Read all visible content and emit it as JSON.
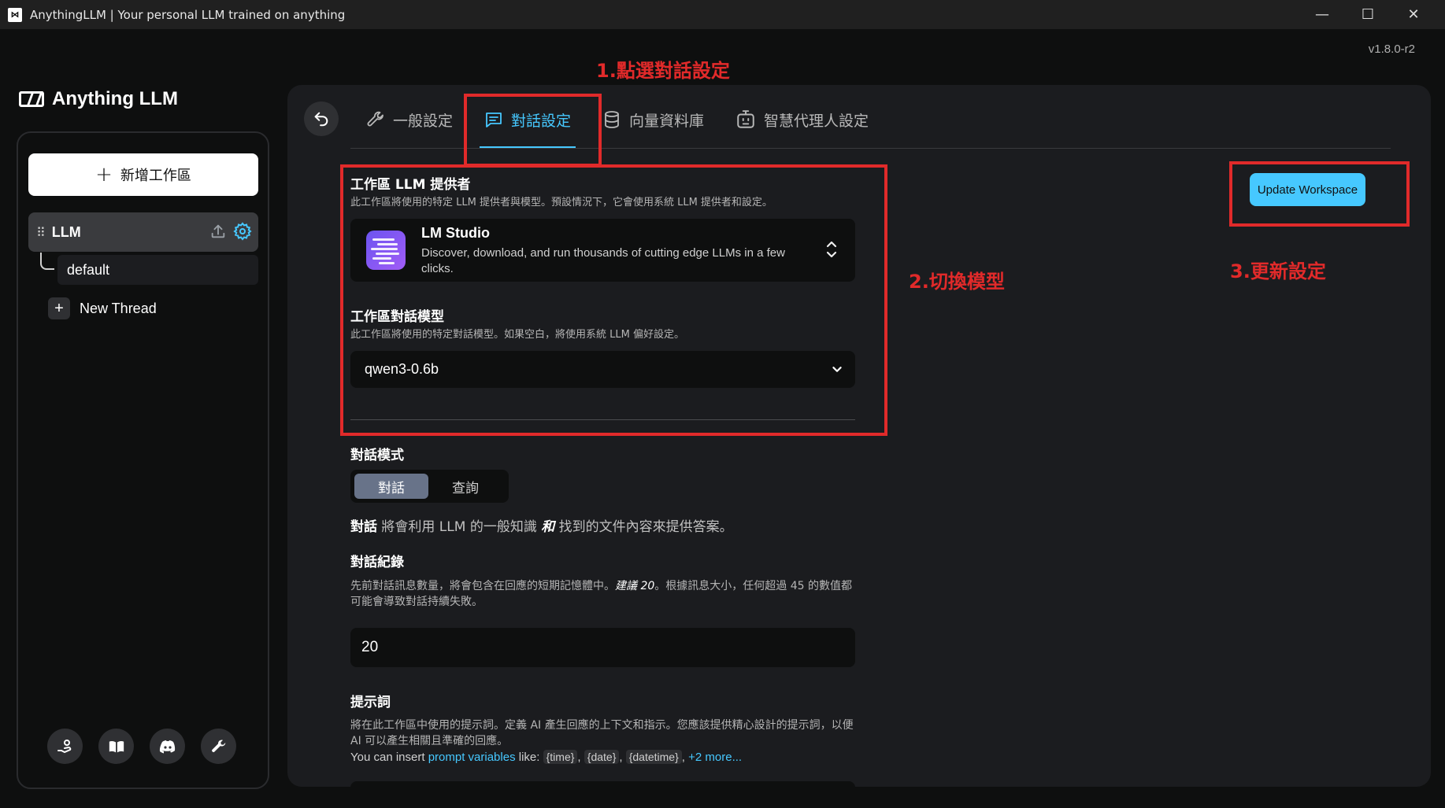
{
  "window": {
    "icon": "anythingllm-app-icon",
    "icon_text": "⋈",
    "title": "AnythingLLM | Your personal LLM trained on anything",
    "minimize": "—",
    "maximize": "☐",
    "close": "✕"
  },
  "version": "v1.8.0-r2",
  "logo": {
    "text": "Anything LLM"
  },
  "sidebar": {
    "new_workspace_label": "新增工作區",
    "new_workspace_plus": "+",
    "workspace": {
      "drag_handle": "⠿",
      "name": "LLM"
    },
    "thread": {
      "name": "default"
    },
    "new_thread_label": "New Thread",
    "new_thread_plus": "+",
    "footer_icons": [
      "community-hub-icon",
      "docs-book-icon",
      "discord-icon",
      "settings-wrench-icon"
    ]
  },
  "tabs": [
    {
      "label": "一般設定",
      "icon": "wrench-icon"
    },
    {
      "label": "對話設定",
      "icon": "chat-icon",
      "active": true
    },
    {
      "label": "向量資料庫",
      "icon": "database-icon"
    },
    {
      "label": "智慧代理人設定",
      "icon": "robot-icon"
    }
  ],
  "llm_provider": {
    "label": "工作區 LLM 提供者",
    "description": "此工作區將使用的特定 LLM 提供者與模型。預設情況下，它會使用系統 LLM 提供者和設定。",
    "name": "LM Studio",
    "provider_description": "Discover, download, and run thousands of cutting edge LLMs in a few clicks."
  },
  "chat_model": {
    "label": "工作區對話模型",
    "description": "此工作區將使用的特定對話模型。如果空白，將使用系統 LLM 偏好設定。",
    "value": "qwen3-0.6b"
  },
  "chat_mode": {
    "label": "對話模式",
    "options": [
      "對話",
      "查詢"
    ],
    "selected": "對話",
    "desc_bold": "對話",
    "desc_part1": " 將會利用 LLM 的一般知識 ",
    "desc_italic": "和",
    "desc_part2": " 找到的文件內容來提供答案。"
  },
  "chat_history": {
    "label": "對話紀錄",
    "desc_part1": "先前對話訊息數量，將會包含在回應的短期記憶體中。",
    "desc_italic": "建議 20",
    "desc_part2": "。根據訊息大小，任何超過 45 的數值都可能會導致對話持續失敗。",
    "value": "20"
  },
  "prompt": {
    "label": "提示詞",
    "description": "將在此工作區中使用的提示詞。定義 AI 產生回應的上下文和指示。您應該提供精心設計的提示詞，以便 AI 可以產生相關且準確的回應。",
    "vars_prefix": "You can insert",
    "vars_link": "prompt variables",
    "vars_like": "like:",
    "var_chips": [
      "{time}",
      "{date}",
      "{datetime}"
    ],
    "vars_more": "+2 more..."
  },
  "update_button_label": "Update Workspace",
  "annotations": [
    {
      "text": "1.點選對話設定"
    },
    {
      "text": "2.切換模型"
    },
    {
      "text": "3.更新設定"
    }
  ],
  "colors": {
    "accent": "#46c8ff",
    "annotation": "#e12a2a",
    "panel_bg": "#1b1c1f",
    "app_bg": "#0e0f0f"
  }
}
